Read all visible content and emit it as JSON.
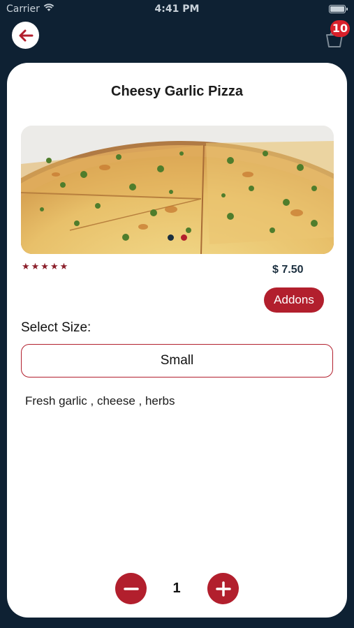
{
  "status_bar": {
    "carrier": "Carrier",
    "time": "4:41 PM"
  },
  "header": {
    "cart_count": "10"
  },
  "product": {
    "title": "Cheesy Garlic Pizza",
    "rating_stars": "★★★★★",
    "price": "$ 7.50",
    "addons_label": "Addons",
    "select_size_label": "Select Size:",
    "selected_size": "Small",
    "description": "Fresh garlic , cheese , herbs"
  },
  "carousel": {
    "slides": 2,
    "active_index": 0
  },
  "quantity": {
    "value": "1"
  },
  "colors": {
    "background": "#0e2133",
    "accent": "#b21f2d",
    "badge": "#d8202a",
    "card": "#ffffff"
  },
  "icons": {
    "back": "arrow-left-icon",
    "cart": "basket-icon",
    "minus": "minus-icon",
    "plus": "plus-icon",
    "rating": "star-icon"
  }
}
